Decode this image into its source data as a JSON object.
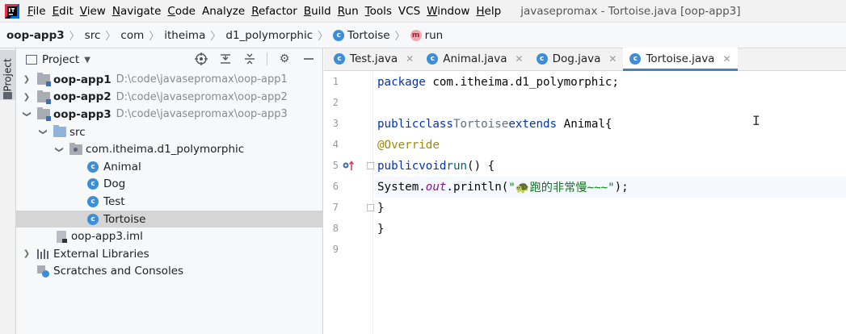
{
  "window": {
    "title": "javasepromax - Tortoise.java [oop-app3]"
  },
  "menu": [
    {
      "label": "File",
      "mnemonic": "F",
      "rest": "ile"
    },
    {
      "label": "Edit",
      "mnemonic": "E",
      "rest": "dit"
    },
    {
      "label": "View",
      "mnemonic": "V",
      "rest": "iew"
    },
    {
      "label": "Navigate",
      "mnemonic": "N",
      "rest": "avigate"
    },
    {
      "label": "Code",
      "mnemonic": "C",
      "rest": "ode"
    },
    {
      "label": "Analyze",
      "mnemonic": "",
      "rest": "Analyze"
    },
    {
      "label": "Refactor",
      "mnemonic": "R",
      "rest": "efactor"
    },
    {
      "label": "Build",
      "mnemonic": "B",
      "rest": "uild"
    },
    {
      "label": "Run",
      "mnemonic": "R",
      "rest": "un"
    },
    {
      "label": "Tools",
      "mnemonic": "T",
      "rest": "ools"
    },
    {
      "label": "VCS",
      "mnemonic": "",
      "rest": "VCS"
    },
    {
      "label": "Window",
      "mnemonic": "W",
      "rest": "indow"
    },
    {
      "label": "Help",
      "mnemonic": "H",
      "rest": "elp"
    }
  ],
  "breadcrumb": {
    "project": "oop-app3",
    "src": "src",
    "com": "com",
    "itheima": "itheima",
    "package": "d1_polymorphic",
    "class": "Tortoise",
    "method": "run",
    "class_badge": "c",
    "method_badge": "m"
  },
  "toolstrip": {
    "project_tab": "Project"
  },
  "project_panel": {
    "title": "Project",
    "tree": {
      "app1": {
        "name": "oop-app1",
        "path": "D:\\code\\javasepromax\\oop-app1"
      },
      "app2": {
        "name": "oop-app2",
        "path": "D:\\code\\javasepromax\\oop-app2"
      },
      "app3": {
        "name": "oop-app3",
        "path": "D:\\code\\javasepromax\\oop-app3"
      },
      "src": "src",
      "package": "com.itheima.d1_polymorphic",
      "classes": [
        "Animal",
        "Dog",
        "Test",
        "Tortoise"
      ],
      "iml": "oop-app3.iml",
      "external": "External Libraries",
      "scratches": "Scratches and Consoles"
    }
  },
  "editor": {
    "tabs": [
      "Test.java",
      "Animal.java",
      "Dog.java",
      "Tortoise.java"
    ],
    "active_tab": "Tortoise.java",
    "line_numbers": [
      "1",
      "2",
      "3",
      "4",
      "5",
      "6",
      "7",
      "8",
      "9"
    ],
    "code": {
      "l1_kw": "package",
      "l1_rest": " com.itheima.d1_polymorphic;",
      "l3_kw1": "public",
      "l3_kw2": "class",
      "l3_name": "Tortoise",
      "l3_kw3": "extends",
      "l3_rest": " Animal{",
      "l4_ann": "@Override",
      "l5_kw1": "public",
      "l5_kw2": "void",
      "l5_fn": "run",
      "l5_rest": "() {",
      "l6_pre": "System.",
      "l6_field": "out",
      "l6_mid": ".println(",
      "l6_str": "\"🐢跑的非常慢~~~\"",
      "l6_end": ");",
      "l7": "}",
      "l8": "}"
    }
  }
}
